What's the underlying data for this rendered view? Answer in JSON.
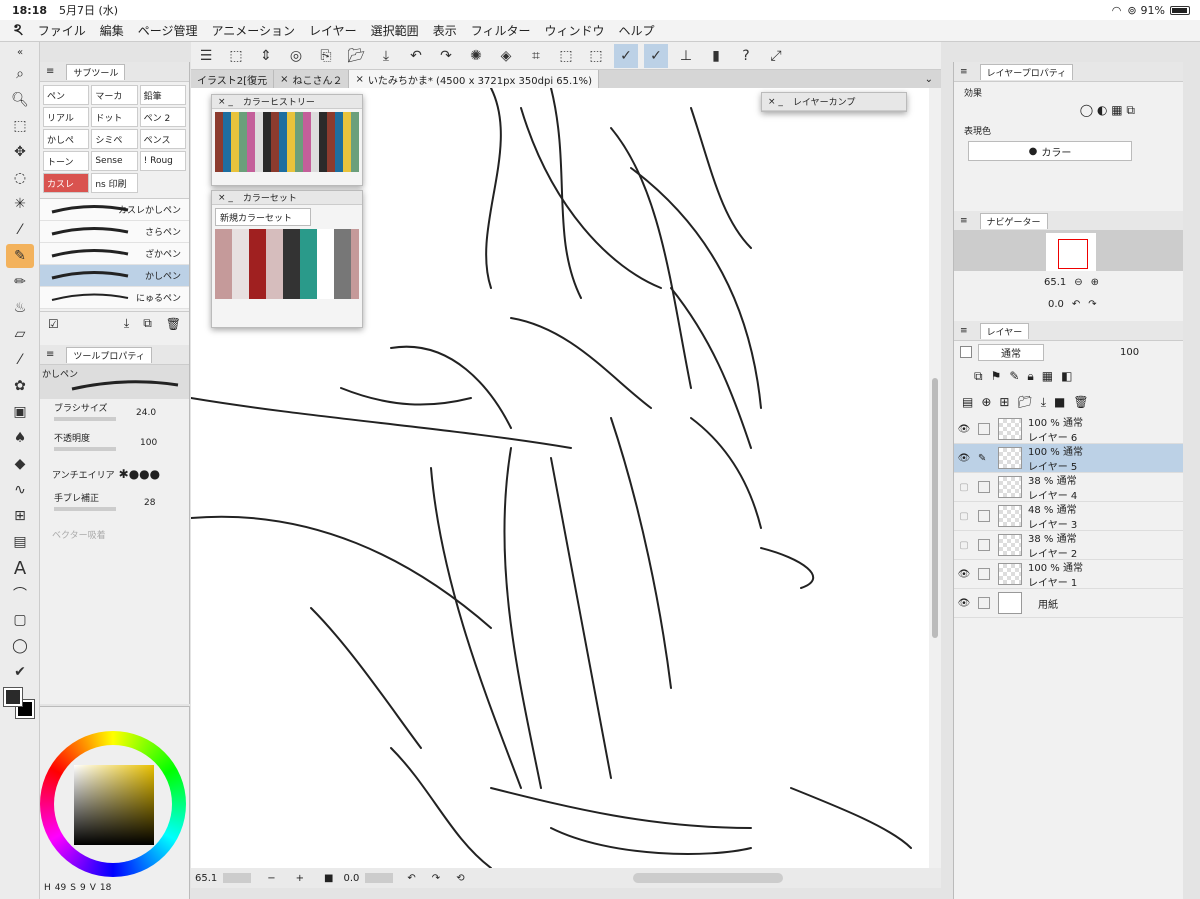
{
  "status": {
    "time": "18:18",
    "date": "5月7日 (水)",
    "battery": "91%"
  },
  "menu": [
    "ファイル",
    "編集",
    "ページ管理",
    "アニメーション",
    "レイヤー",
    "選択範囲",
    "表示",
    "フィルター",
    "ウィンドウ",
    "ヘルプ"
  ],
  "subtool": {
    "title": "サブツール",
    "grid": [
      "ペン",
      "マーカ",
      "鉛筆",
      "リアル",
      "ドット",
      "ペン 2",
      "かしぺ",
      "シミペ",
      "ペンス",
      "トーン",
      "Sense",
      "! Roug",
      "カスレ",
      "ns 印刷",
      ""
    ],
    "brushes": [
      "カスレかしペン",
      "さらペン",
      "ざかペン",
      "かしペン",
      "にゅるペン"
    ],
    "selected_brush": "かしペン"
  },
  "tool_property": {
    "title": "ツールプロパティ",
    "name": "かしペン",
    "brush_size_label": "ブラシサイズ",
    "brush_size": "24.0",
    "opacity_label": "不透明度",
    "opacity": "100",
    "antialias_label": "アンチエイリア",
    "stabilization_label": "手ブレ補正",
    "stabilization": "28",
    "vector_label": "ベクター吸着"
  },
  "color": {
    "h": "49",
    "s": "9",
    "v": "18",
    "h_label": "H",
    "s_label": "S",
    "v_label": "V",
    "main": "#2a2a2a",
    "sub": "#000000"
  },
  "tabs": [
    "イラスト2[復元",
    "ねこさん２",
    "いたみちかま* (4500 x 3721px 350dpi 65.1%)"
  ],
  "color_history": {
    "title": "カラーヒストリー"
  },
  "color_set": {
    "title": "カラーセット",
    "dropdown": "新規カラーセット"
  },
  "layer_comp": {
    "title": "レイヤーカンプ"
  },
  "canvas_bottom": {
    "zoom": "65.1",
    "angle": "0.0"
  },
  "layer_property": {
    "title": "レイヤープロパティ",
    "effect_label": "効果",
    "color_label": "表現色",
    "color_value": "カラー"
  },
  "navigator": {
    "title": "ナビゲーター",
    "zoom": "65.1",
    "angle": "0.0"
  },
  "layers_panel": {
    "title": "レイヤー",
    "blend": "通常",
    "opacity": "100",
    "layers": [
      {
        "name": "レイヤー 6",
        "info": "100 %  通常",
        "visible": true
      },
      {
        "name": "レイヤー 5",
        "info": "100 %  通常",
        "visible": true
      },
      {
        "name": "レイヤー 4",
        "info": "38 %  通常",
        "visible": false
      },
      {
        "name": "レイヤー 3",
        "info": "48 %  通常",
        "visible": false
      },
      {
        "name": "レイヤー 2",
        "info": "38 %  通常",
        "visible": false
      },
      {
        "name": "レイヤー 1",
        "info": "100 %  通常",
        "visible": true
      }
    ],
    "paper": "用紙"
  }
}
